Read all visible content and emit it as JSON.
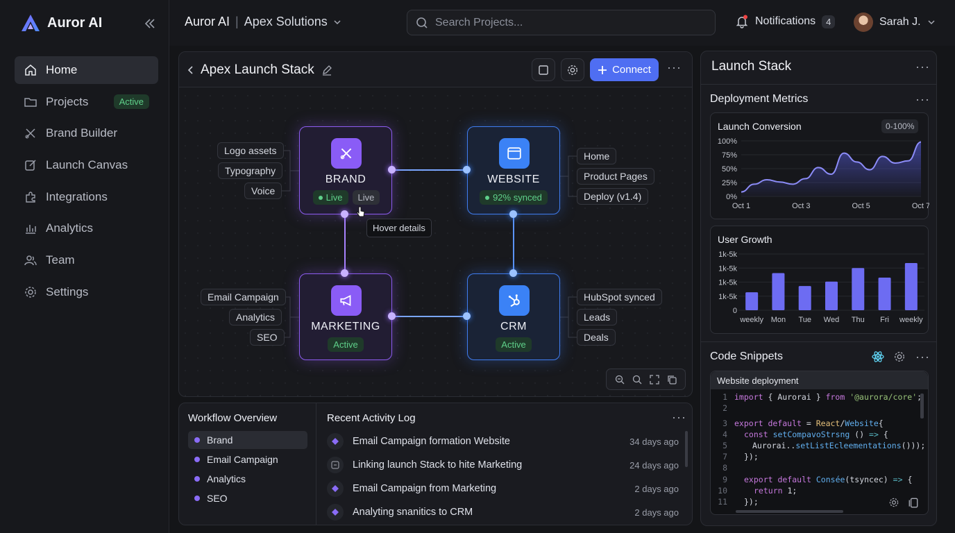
{
  "app": {
    "name": "Auror AI"
  },
  "sidebar": {
    "items": [
      {
        "label": "Home",
        "icon": "home-icon"
      },
      {
        "label": "Projects",
        "icon": "folder-icon",
        "badge": "Active"
      },
      {
        "label": "Brand Builder",
        "icon": "brand-tools-icon"
      },
      {
        "label": "Launch Canvas",
        "icon": "edit-icon"
      },
      {
        "label": "Integrations",
        "icon": "puzzle-icon"
      },
      {
        "label": "Analytics",
        "icon": "bar-chart-icon"
      },
      {
        "label": "Team",
        "icon": "team-icon"
      },
      {
        "label": "Settings",
        "icon": "gear-icon"
      }
    ]
  },
  "header": {
    "app": "Auror AI",
    "workspace": "Apex Solutions",
    "search_placeholder": "Search Projects...",
    "notifications_label": "Notifications",
    "notifications_count": "4",
    "user_name": "Sarah J."
  },
  "canvas": {
    "title": "Apex Launch Stack",
    "connect_label": "Connect",
    "tooltip": "Hover details",
    "nodes": {
      "brand": {
        "label": "BRAND",
        "tag1": "Live",
        "tag2": "Live"
      },
      "website": {
        "label": "WEBSITE",
        "tag": "92% synced"
      },
      "marketing": {
        "label": "MARKETING",
        "tag": "Active"
      },
      "crm": {
        "label": "CRM",
        "tag": "Active"
      }
    },
    "brand_chips": [
      "Logo assets",
      "Typography",
      "Voice"
    ],
    "website_chips": [
      "Home",
      "Product Pages",
      "Deploy (v1.4)"
    ],
    "marketing_chips": [
      "Email Campaign",
      "Analytics",
      "SEO"
    ],
    "crm_chips": [
      "HubSpot synced",
      "Leads",
      "Deals"
    ]
  },
  "workflow": {
    "title": "Workflow Overview",
    "items": [
      "Brand",
      "Email Campaign",
      "Analytics",
      "SEO"
    ]
  },
  "activity": {
    "title": "Recent Activity Log",
    "rows": [
      {
        "text": "Email Campaign formation Website",
        "time": "34 days ago"
      },
      {
        "text": "Linking launch Stack to hite Marketing",
        "time": "24 days ago"
      },
      {
        "text": "Email Campaign from Marketing",
        "time": "2 days ago"
      },
      {
        "text": "Analyting snanitics to CRM",
        "time": "2 days ago"
      }
    ]
  },
  "right_panel": {
    "title": "Launch Stack",
    "metrics_title": "Deployment Metrics",
    "code_title": "Code Snippets",
    "code_file": "Website deployment"
  },
  "chart_data": [
    {
      "type": "area",
      "title": "Launch Conversion",
      "range_badge": "0-100%",
      "x_ticks": [
        "Oct 1",
        "Oct 3",
        "Oct 5",
        "Oct 7"
      ],
      "y_ticks": [
        "100%",
        "75%",
        "50%",
        "25%",
        "0%"
      ],
      "ylim": [
        0,
        100
      ],
      "values": [
        8,
        22,
        30,
        26,
        22,
        32,
        52,
        40,
        78,
        62,
        48,
        72,
        60,
        64,
        98
      ],
      "colors": {
        "line": "#8c8cf8",
        "fill": "#4a4fb8"
      }
    },
    {
      "type": "bar",
      "title": "User Growth",
      "categories": [
        "weekly",
        "Mon",
        "Tue",
        "Wed",
        "Thu",
        "Fri",
        "weekly"
      ],
      "y_ticks": [
        "1k-5k",
        "1k-5k",
        "1k-5k",
        "1k-5k",
        "0"
      ],
      "values": [
        32,
        66,
        43,
        51,
        75,
        58,
        84
      ],
      "ylim": [
        0,
        100
      ],
      "colors": {
        "bar": "#6d6cf2"
      }
    }
  ]
}
